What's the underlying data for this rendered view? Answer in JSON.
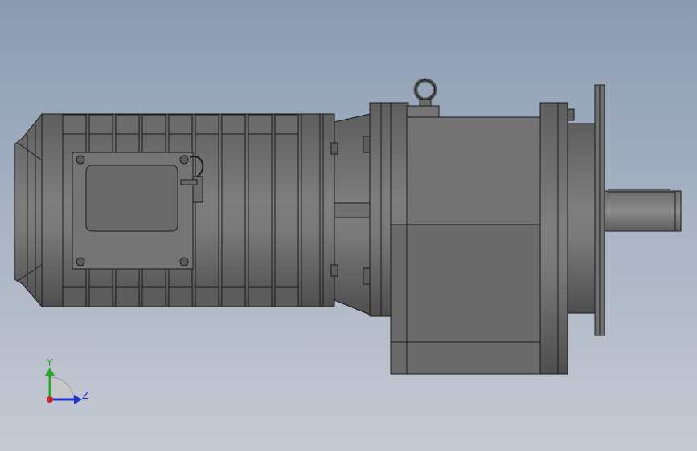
{
  "colors": {
    "background_top": "#8a9cb2",
    "background_bottom": "#c6cad4",
    "part_fill": "#6e6e6e",
    "part_dark": "#5a5a5a",
    "part_light": "#8a8a8a",
    "outline": "#1a1a1a",
    "axis_y": "#22aa22",
    "axis_z": "#2233cc",
    "axis_x": "#cc2222"
  },
  "triad": {
    "y_label": "Y",
    "z_label": "Z"
  }
}
